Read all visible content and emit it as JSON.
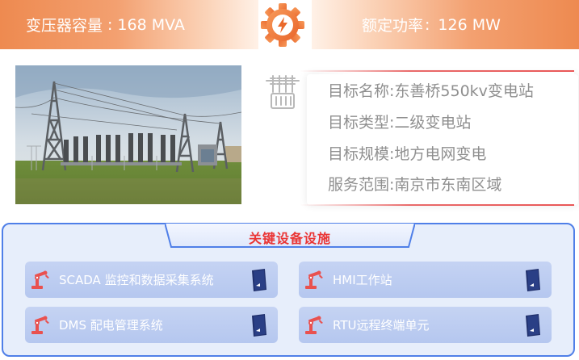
{
  "top_stats": {
    "capacity_label": "变压器容量",
    "capacity_colon": ":",
    "capacity_value": "168 MVA",
    "power_label": "额定功率",
    "power_colon": ":",
    "power_value": "126 MW"
  },
  "target_info": {
    "rows": [
      {
        "label": "目标名称:",
        "value": "东善桥550kv变电站"
      },
      {
        "label": "目标类型:",
        "value": "二级变电站"
      },
      {
        "label": "目标规模:",
        "value": "地方电网变电"
      },
      {
        "label": "服务范围:",
        "value": "南京市东南区域"
      }
    ]
  },
  "facilities": {
    "title": "关键设备设施",
    "items": [
      {
        "label": "SCADA 监控和数据采集系统"
      },
      {
        "label": "HMI工作站"
      },
      {
        "label": "DMS 配电管理系统"
      },
      {
        "label": "RTU远程终端单元"
      }
    ]
  },
  "colors": {
    "accent_orange": "#ee8a50",
    "accent_red": "#ea3535",
    "facility_border": "#4f7fe8",
    "facility_bg": "#e7eefb",
    "item_bg": "#b5c7ef",
    "icon_navy": "#1f2f6b"
  },
  "icons": {
    "badge": "lightning-gear-icon",
    "panel": "transformer-icon",
    "item_left": "robot-arm-icon",
    "item_right": "server-cabinet-icon"
  }
}
